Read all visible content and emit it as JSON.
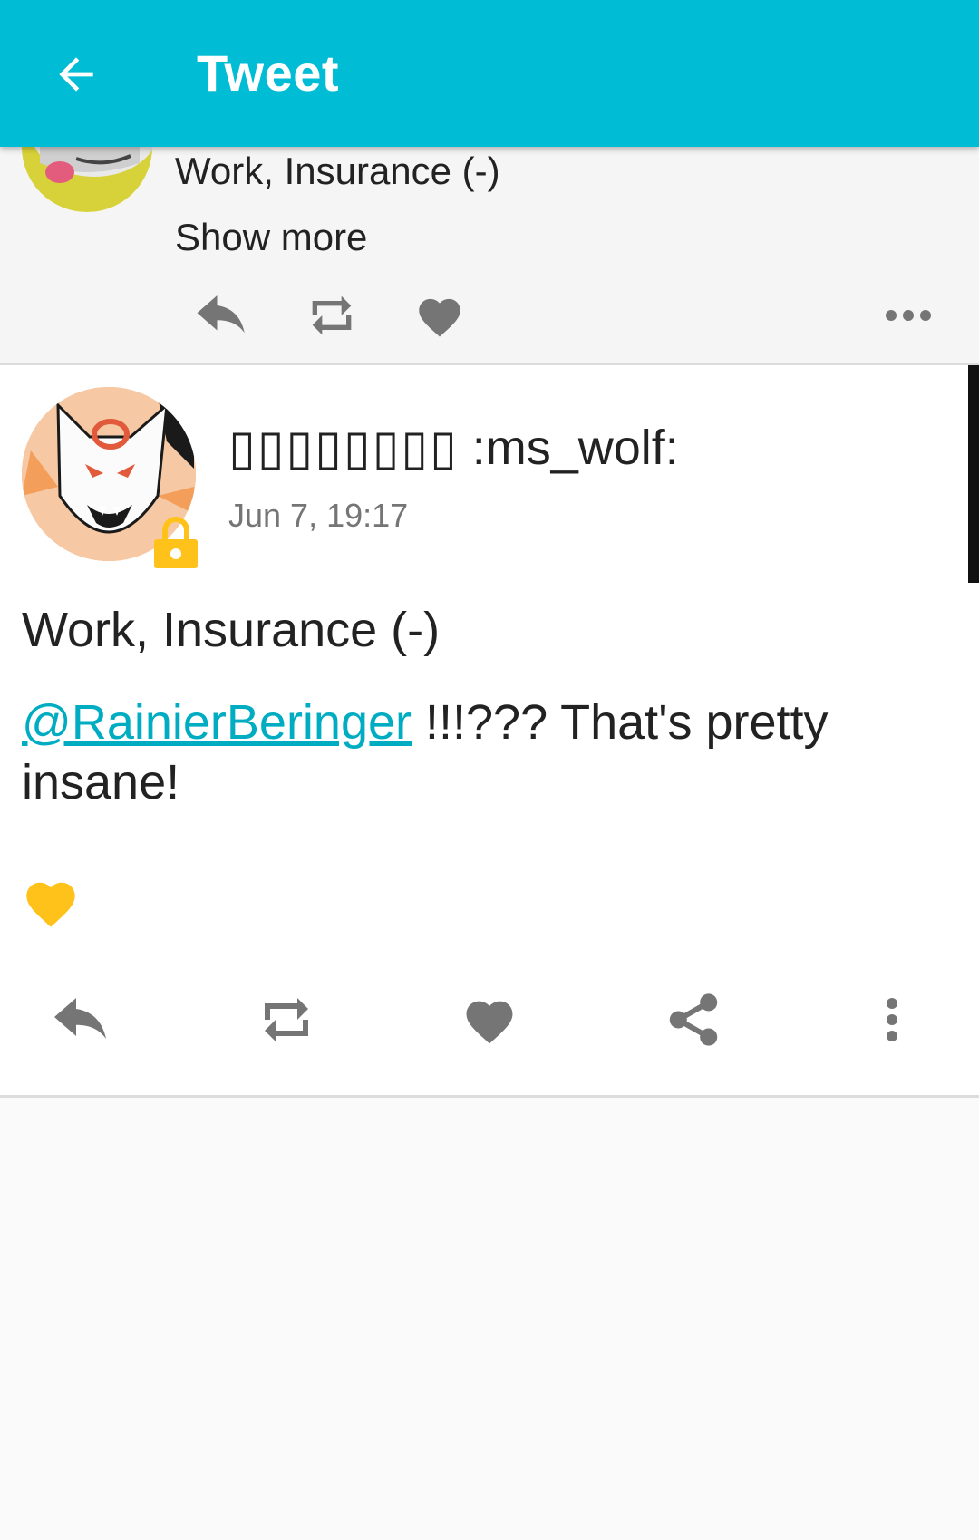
{
  "app_bar": {
    "title": "Tweet",
    "back_icon": "arrow-left-icon",
    "background": "#00bcd4"
  },
  "previous_status": {
    "content_warning": "Work, Insurance (-)",
    "show_more_label": "Show more",
    "actions": [
      "reply-icon",
      "retweet-icon",
      "heart-icon",
      "more-horizontal-icon"
    ]
  },
  "status": {
    "display_name_boxes": "▯▯▯▯▯▯▯▯",
    "display_name_suffix": " :ms_wolf:",
    "timestamp": "Jun 7, 19:17",
    "locked": true,
    "content_warning": "Work, Insurance (-)",
    "mention": "@RainierBeringer",
    "body_rest": " !!!??? That's pretty insane!",
    "favourited_indicator_color": "#ffc21a",
    "actions": [
      "reply-icon",
      "retweet-icon",
      "heart-icon",
      "share-icon",
      "more-vertical-icon"
    ]
  },
  "colors": {
    "accent": "#00bcd4",
    "link": "#00acc1",
    "icon_gray": "#757575",
    "lock": "#ffc21a"
  }
}
